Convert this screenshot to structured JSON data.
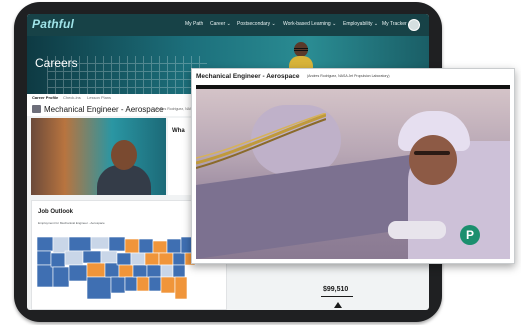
{
  "app": {
    "logo_text": "Pathful",
    "nav": [
      "My Path",
      "Career ⌄",
      "Postsecondary ⌄",
      "Work-based Learning ⌄",
      "Employability ⌄",
      "My Tracker ⌄"
    ]
  },
  "hero": {
    "title": "Careers"
  },
  "tabs": [
    "Career Profile",
    "Check-ins",
    "Lesson Plans"
  ],
  "career": {
    "title": "Mechanical Engineer - Aerospace",
    "subtitle": "(Andres Rodriguez, NASA)"
  },
  "side_card": {
    "title": "Wha"
  },
  "outlook": {
    "title": "Job Outlook",
    "subtitle": "Employment for Mechanical Engineer - Aerospace"
  },
  "salary": {
    "value": "$99,510"
  },
  "popup": {
    "title": "Mechanical Engineer - Aerospace",
    "subtitle": "(Andres Rodriguez, NASA Jet Propulsion Laboratory)",
    "badge": "P"
  },
  "colors": {
    "nav_bg": "#174247",
    "map_blue": "#3f6fb2",
    "map_orange": "#f0953a",
    "map_light": "#c9d6e8",
    "badge_green": "#1b8f6e"
  }
}
